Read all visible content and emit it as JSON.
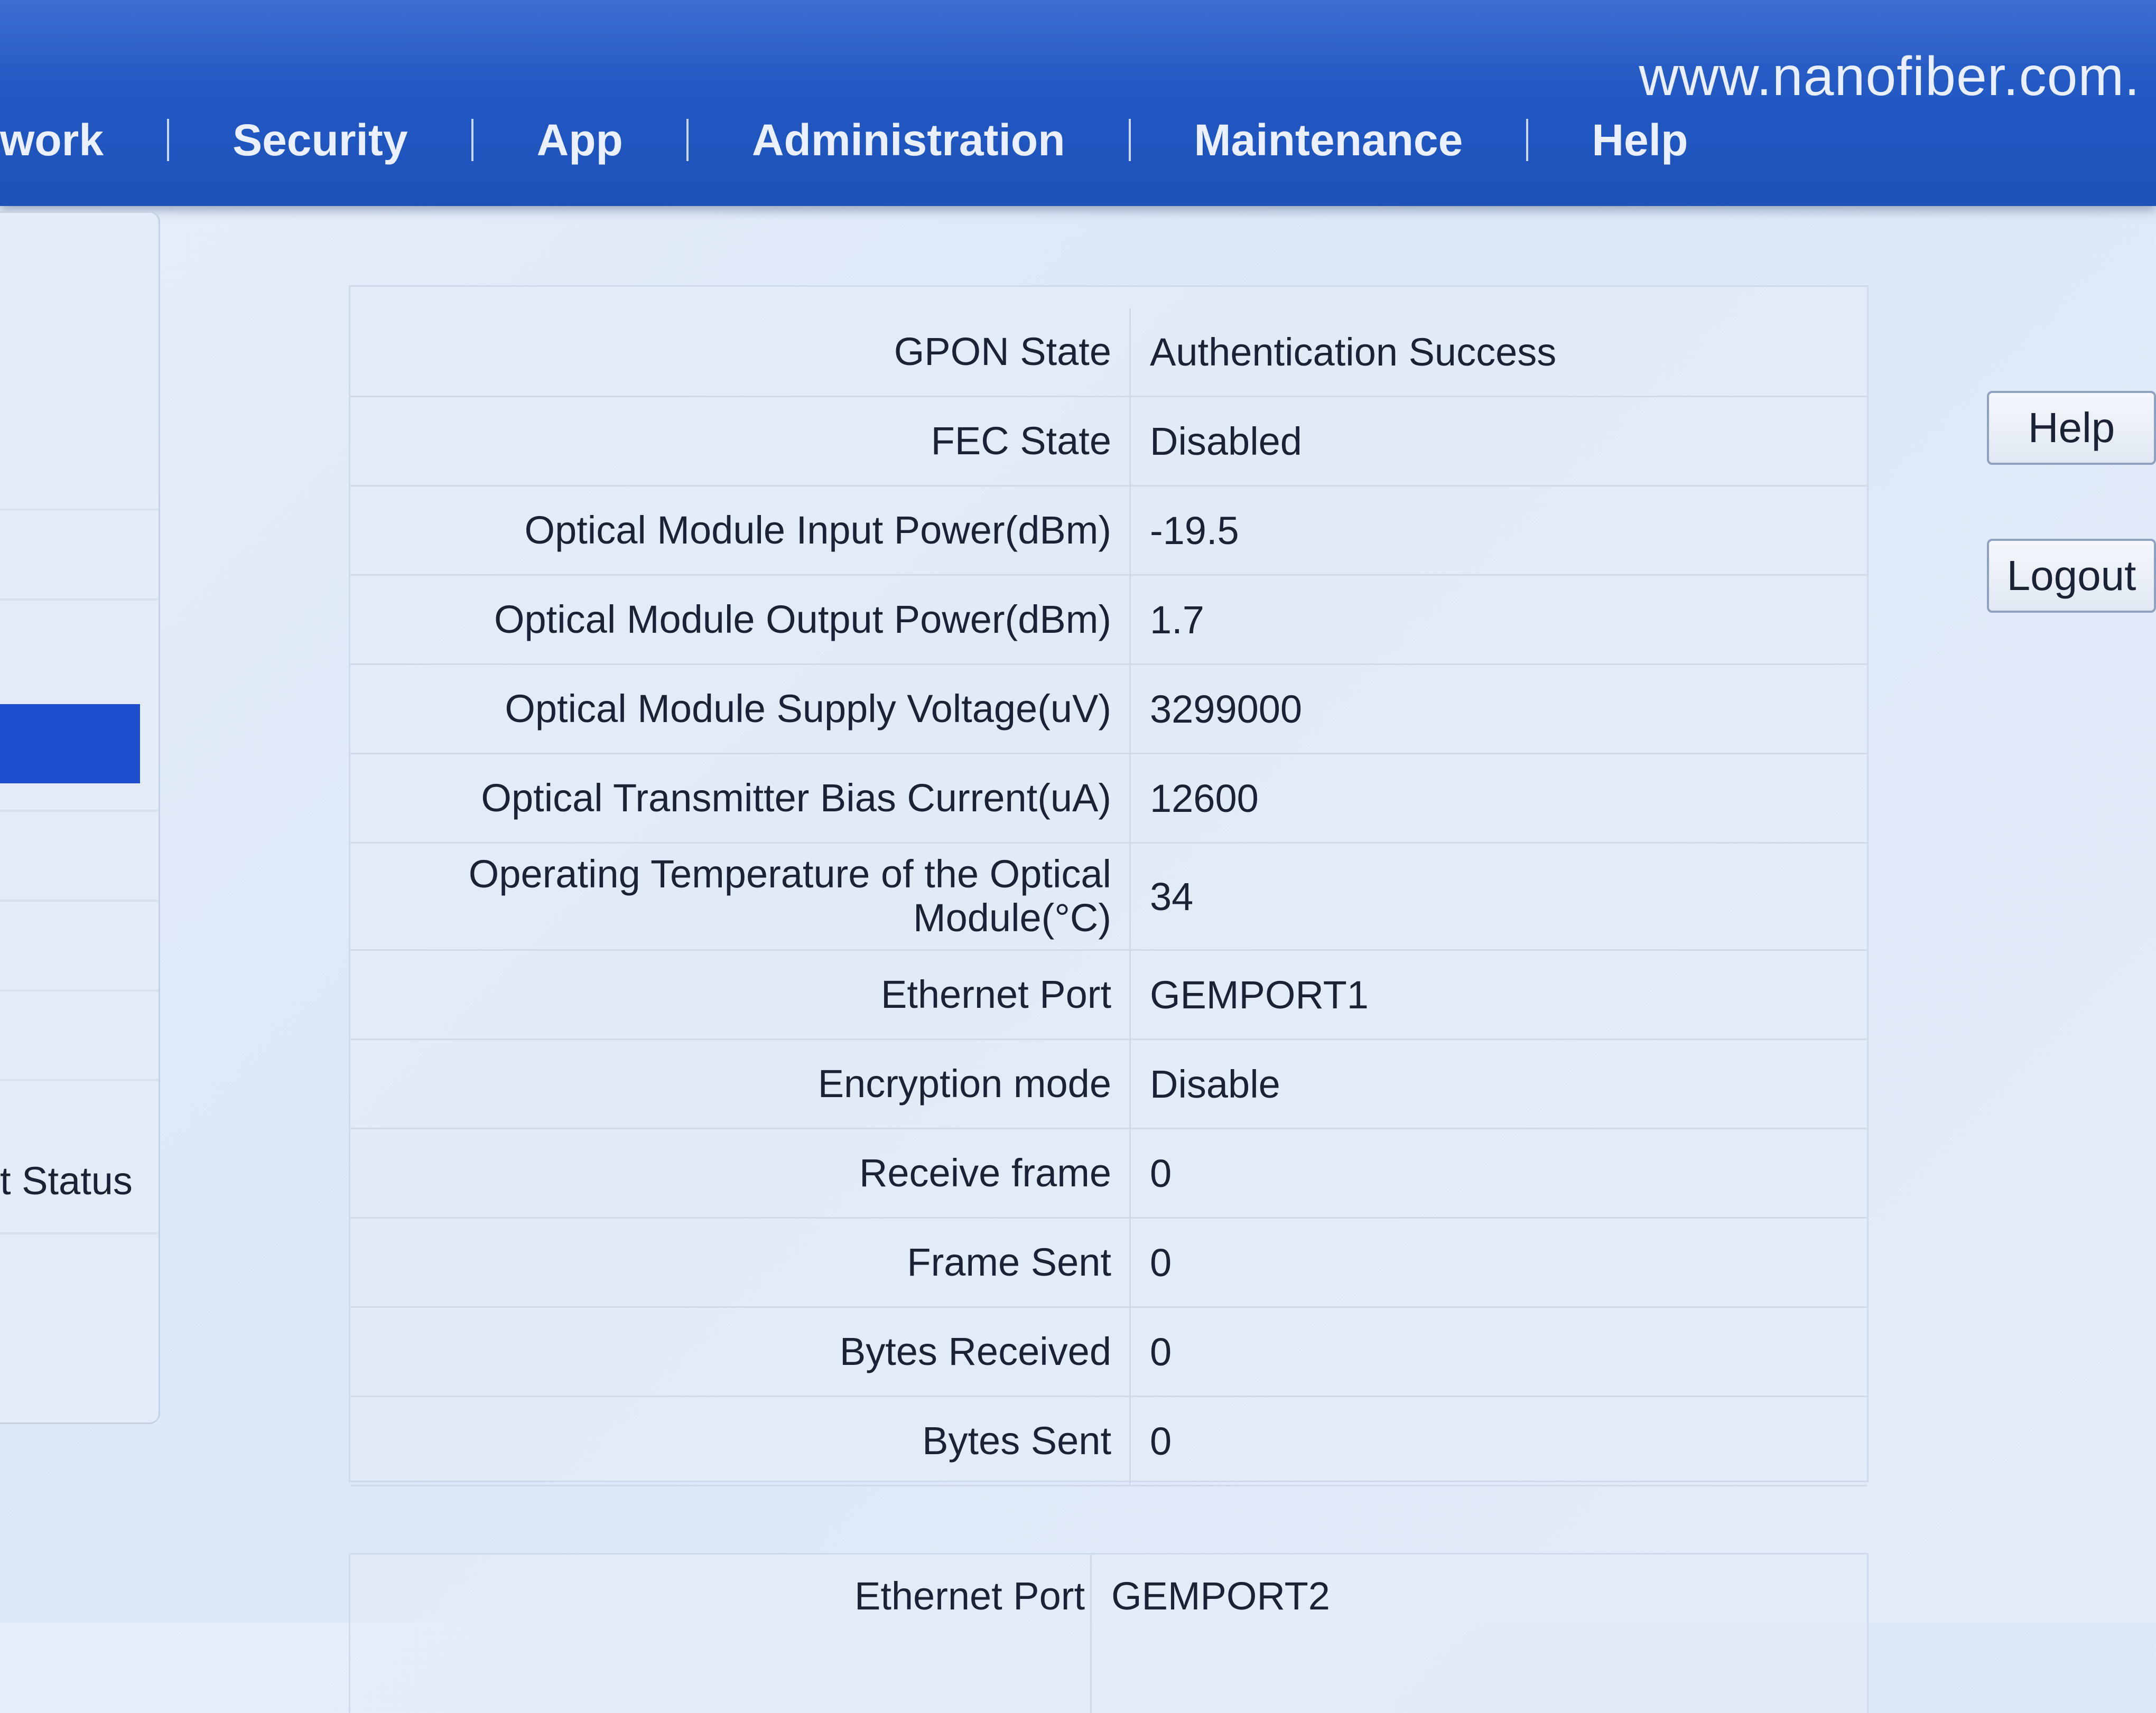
{
  "header": {
    "url": "www.nanofiber.com.",
    "nav": [
      {
        "label": "work"
      },
      {
        "label": "Security"
      },
      {
        "label": "App"
      },
      {
        "label": "Administration"
      },
      {
        "label": "Maintenance"
      },
      {
        "label": "Help"
      }
    ]
  },
  "sidebar": {
    "status_label": "t Status"
  },
  "buttons": {
    "help": "Help",
    "logout": "Logout"
  },
  "info": {
    "rows": [
      {
        "label": "GPON State",
        "value": "Authentication Success"
      },
      {
        "label": "FEC State",
        "value": "Disabled"
      },
      {
        "label": "Optical Module Input Power(dBm)",
        "value": "-19.5"
      },
      {
        "label": "Optical Module Output Power(dBm)",
        "value": "1.7"
      },
      {
        "label": "Optical Module Supply Voltage(uV)",
        "value": "3299000"
      },
      {
        "label": "Optical Transmitter Bias Current(uA)",
        "value": "12600"
      },
      {
        "label": "Operating Temperature of the Optical Module(°C)",
        "value": "34"
      },
      {
        "label": "Ethernet Port",
        "value": "GEMPORT1"
      },
      {
        "label": "Encryption mode",
        "value": "Disable"
      },
      {
        "label": "Receive frame",
        "value": "0"
      },
      {
        "label": "Frame Sent",
        "value": "0"
      },
      {
        "label": "Bytes Received",
        "value": "0"
      },
      {
        "label": "Bytes Sent",
        "value": "0"
      }
    ],
    "second_port": {
      "label": "Ethernet Port",
      "value": "GEMPORT2"
    }
  }
}
